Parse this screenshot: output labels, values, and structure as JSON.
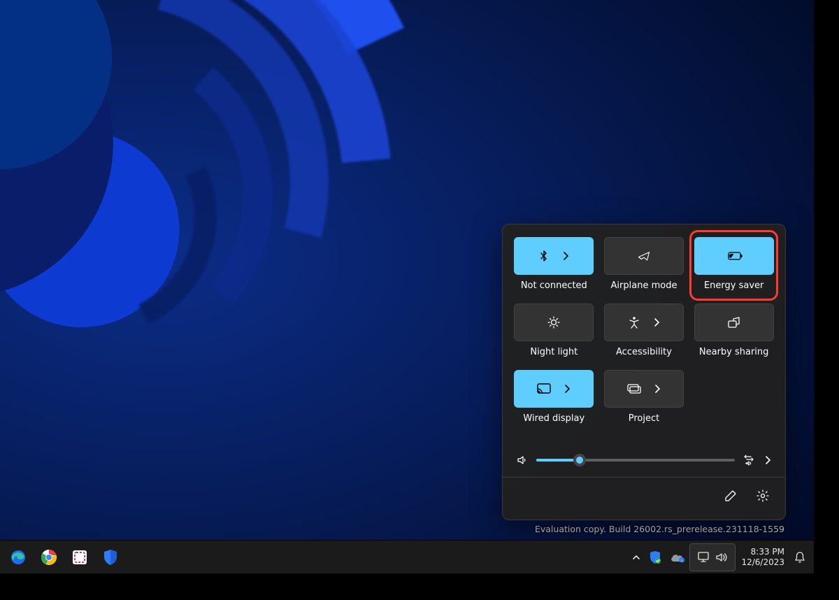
{
  "quick_settings": {
    "tiles": [
      {
        "label": "Not connected",
        "state": "on",
        "chevron": true
      },
      {
        "label": "Airplane mode",
        "state": "off",
        "chevron": false
      },
      {
        "label": "Energy saver",
        "state": "on",
        "chevron": false,
        "highlighted": true
      },
      {
        "label": "Night light",
        "state": "off",
        "chevron": false
      },
      {
        "label": "Accessibility",
        "state": "off",
        "chevron": true
      },
      {
        "label": "Nearby sharing",
        "state": "off",
        "chevron": false
      },
      {
        "label": "Wired display",
        "state": "on",
        "chevron": true
      },
      {
        "label": "Project",
        "state": "off",
        "chevron": true
      }
    ],
    "volume_percent": 22
  },
  "watermark": "Evaluation copy. Build 26002.rs_prerelease.231118-1559",
  "taskbar": {
    "time": "8:33 PM",
    "date": "12/6/2023"
  },
  "icons": {
    "bluetooth": "bluetooth",
    "airplane": "airplane",
    "battery_leaf": "energy-saver",
    "night_light": "night-light",
    "accessibility": "accessibility",
    "nearby_share": "nearby-sharing",
    "cast": "cast",
    "project": "project"
  }
}
